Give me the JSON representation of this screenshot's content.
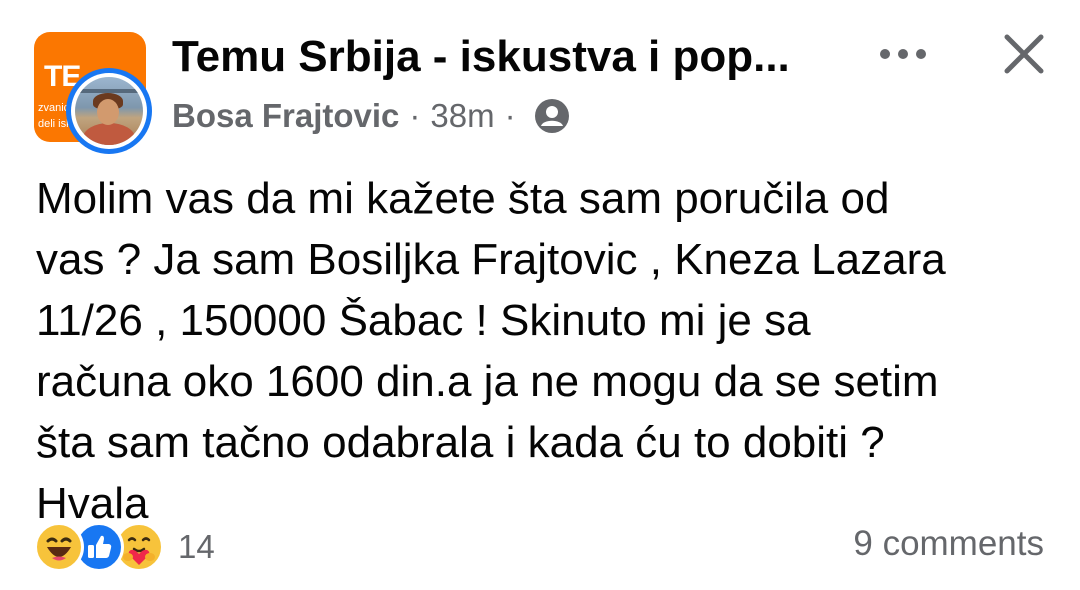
{
  "header": {
    "group_name": "Temu Srbija - iskustva i pop...",
    "group_avatar_text": "TE",
    "group_avatar_sub1": "zvanic",
    "group_avatar_sub2": "deli isk",
    "author": "Bosa Frajtovic",
    "separator_1": "·",
    "time": "38m",
    "separator_2": "·",
    "audience_icon": "group-audience-icon",
    "more_icon": "more-dots-icon",
    "close_icon": "close-icon"
  },
  "post": {
    "lines": [
      "Molim vas da mi kažete šta sam poručila od",
      "vas ? Ja sam Bosiljka Frajtovic , Kneza Lazara",
      "11/26 , 150000 Šabac ! Skinuto mi je sa",
      "računa oko 1600 din.a ja ne mogu da se setim",
      "šta sam tačno odabrala i kada ću to dobiti ?",
      "Hvala"
    ]
  },
  "footer": {
    "reactions": [
      "haha-reaction-icon",
      "like-reaction-icon",
      "care-reaction-icon"
    ],
    "reaction_count": "14",
    "comments": "9 comments"
  },
  "colors": {
    "text_primary": "#050505",
    "text_secondary": "#65676b",
    "brand_blue": "#1877f2",
    "temu_orange": "#fb7701",
    "reaction_yellow": "#f7c33b"
  }
}
